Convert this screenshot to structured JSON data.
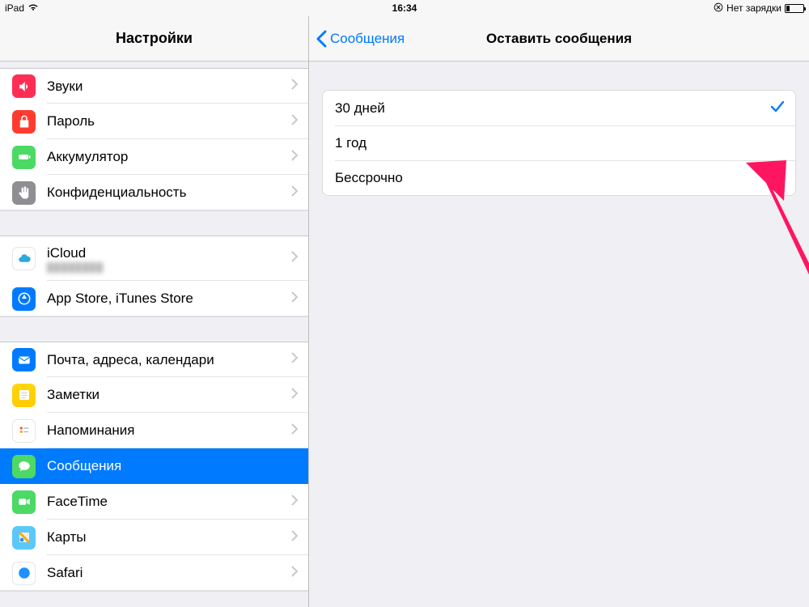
{
  "statusbar": {
    "device": "iPad",
    "time": "16:34",
    "charging_text": "Нет зарядки"
  },
  "left": {
    "title": "Настройки",
    "group1": [
      {
        "label": "Звуки",
        "icon": "sound-icon",
        "color": "red2"
      },
      {
        "label": "Пароль",
        "icon": "lock-icon",
        "color": "red"
      },
      {
        "label": "Аккумулятор",
        "icon": "battery-icon",
        "color": "green"
      },
      {
        "label": "Конфиденциальность",
        "icon": "hand-icon",
        "color": "grey"
      }
    ],
    "group2": [
      {
        "label": "iCloud",
        "sub": "████████",
        "icon": "icloud-icon",
        "color": "white"
      },
      {
        "label": "App Store, iTunes Store",
        "icon": "appstore-icon",
        "color": "blue"
      }
    ],
    "group3": [
      {
        "label": "Почта, адреса, календари",
        "icon": "mail-icon",
        "color": "blue"
      },
      {
        "label": "Заметки",
        "icon": "notes-icon",
        "color": "orange"
      },
      {
        "label": "Напоминания",
        "icon": "reminders-icon",
        "color": "white"
      },
      {
        "label": "Сообщения",
        "icon": "messages-icon",
        "color": "green",
        "selected": true
      },
      {
        "label": "FaceTime",
        "icon": "facetime-icon",
        "color": "facetime"
      },
      {
        "label": "Карты",
        "icon": "maps-icon",
        "color": "teal"
      },
      {
        "label": "Safari",
        "icon": "safari-icon",
        "color": "white"
      }
    ]
  },
  "right": {
    "back_label": "Сообщения",
    "title": "Оставить сообщения",
    "options": [
      {
        "label": "30 дней",
        "selected": true
      },
      {
        "label": "1 год",
        "selected": false
      },
      {
        "label": "Бессрочно",
        "selected": false
      }
    ]
  },
  "colors": {
    "accent": "#007aff",
    "annotation": "#ff1560"
  }
}
